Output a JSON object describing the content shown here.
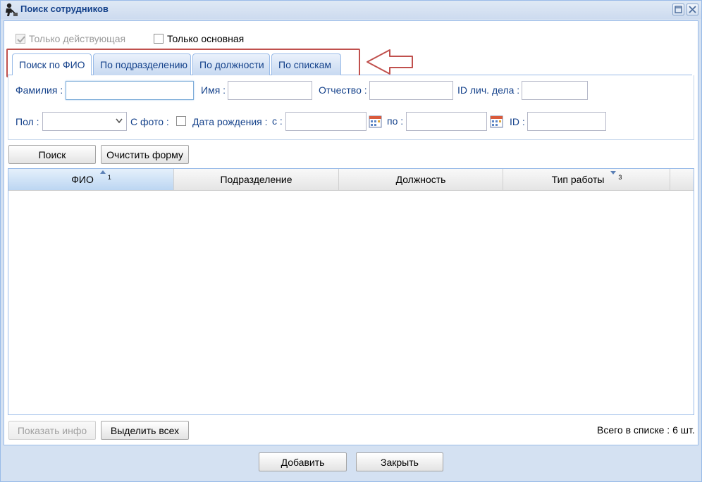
{
  "window": {
    "title": "Поиск сотрудников",
    "icon": "worker-icon",
    "accent": "#15428b",
    "border": "#99bbe8"
  },
  "filters": {
    "only_active": {
      "label": "Только действующая",
      "checked": true,
      "disabled": true
    },
    "only_main": {
      "label": "Только основная",
      "checked": false
    }
  },
  "tabs": [
    {
      "label": "Поиск по ФИО",
      "active": true
    },
    {
      "label": "По подразделению",
      "active": false
    },
    {
      "label": "По должности",
      "active": false
    },
    {
      "label": "По спискам",
      "active": false
    }
  ],
  "annotation": {
    "highlight_color": "#c0504d",
    "arrow": "left-arrow-icon"
  },
  "form": {
    "surname_label": "Фамилия :",
    "surname_value": "",
    "name_label": "Имя :",
    "name_value": "",
    "patronymic_label": "Отчество :",
    "patronymic_value": "",
    "case_id_label": "ID лич. дела :",
    "case_id_value": "",
    "gender_label": "Пол :",
    "gender_value": "",
    "photo_label": "С фото :",
    "photo_checked": false,
    "birth_label": "Дата рождения :",
    "from_label": "с :",
    "from_value": "",
    "to_label": "по :",
    "to_value": "",
    "id_label": "ID :",
    "id_value": ""
  },
  "actions": {
    "search": "Поиск",
    "clear": "Очистить форму"
  },
  "grid": {
    "columns": [
      {
        "label": "ФИО",
        "sort": "asc",
        "sort_order": "1"
      },
      {
        "label": "Подразделение",
        "sort": null,
        "sort_order": ""
      },
      {
        "label": "Должность",
        "sort": null,
        "sort_order": ""
      },
      {
        "label": "Тип работы",
        "sort": "desc",
        "sort_order": "3"
      }
    ],
    "rows": []
  },
  "footer": {
    "show_info": "Показать инфо",
    "select_all": "Выделить всех",
    "total": "Всего в списке : 6 шт."
  },
  "dialog": {
    "add": "Добавить",
    "close": "Закрыть"
  }
}
